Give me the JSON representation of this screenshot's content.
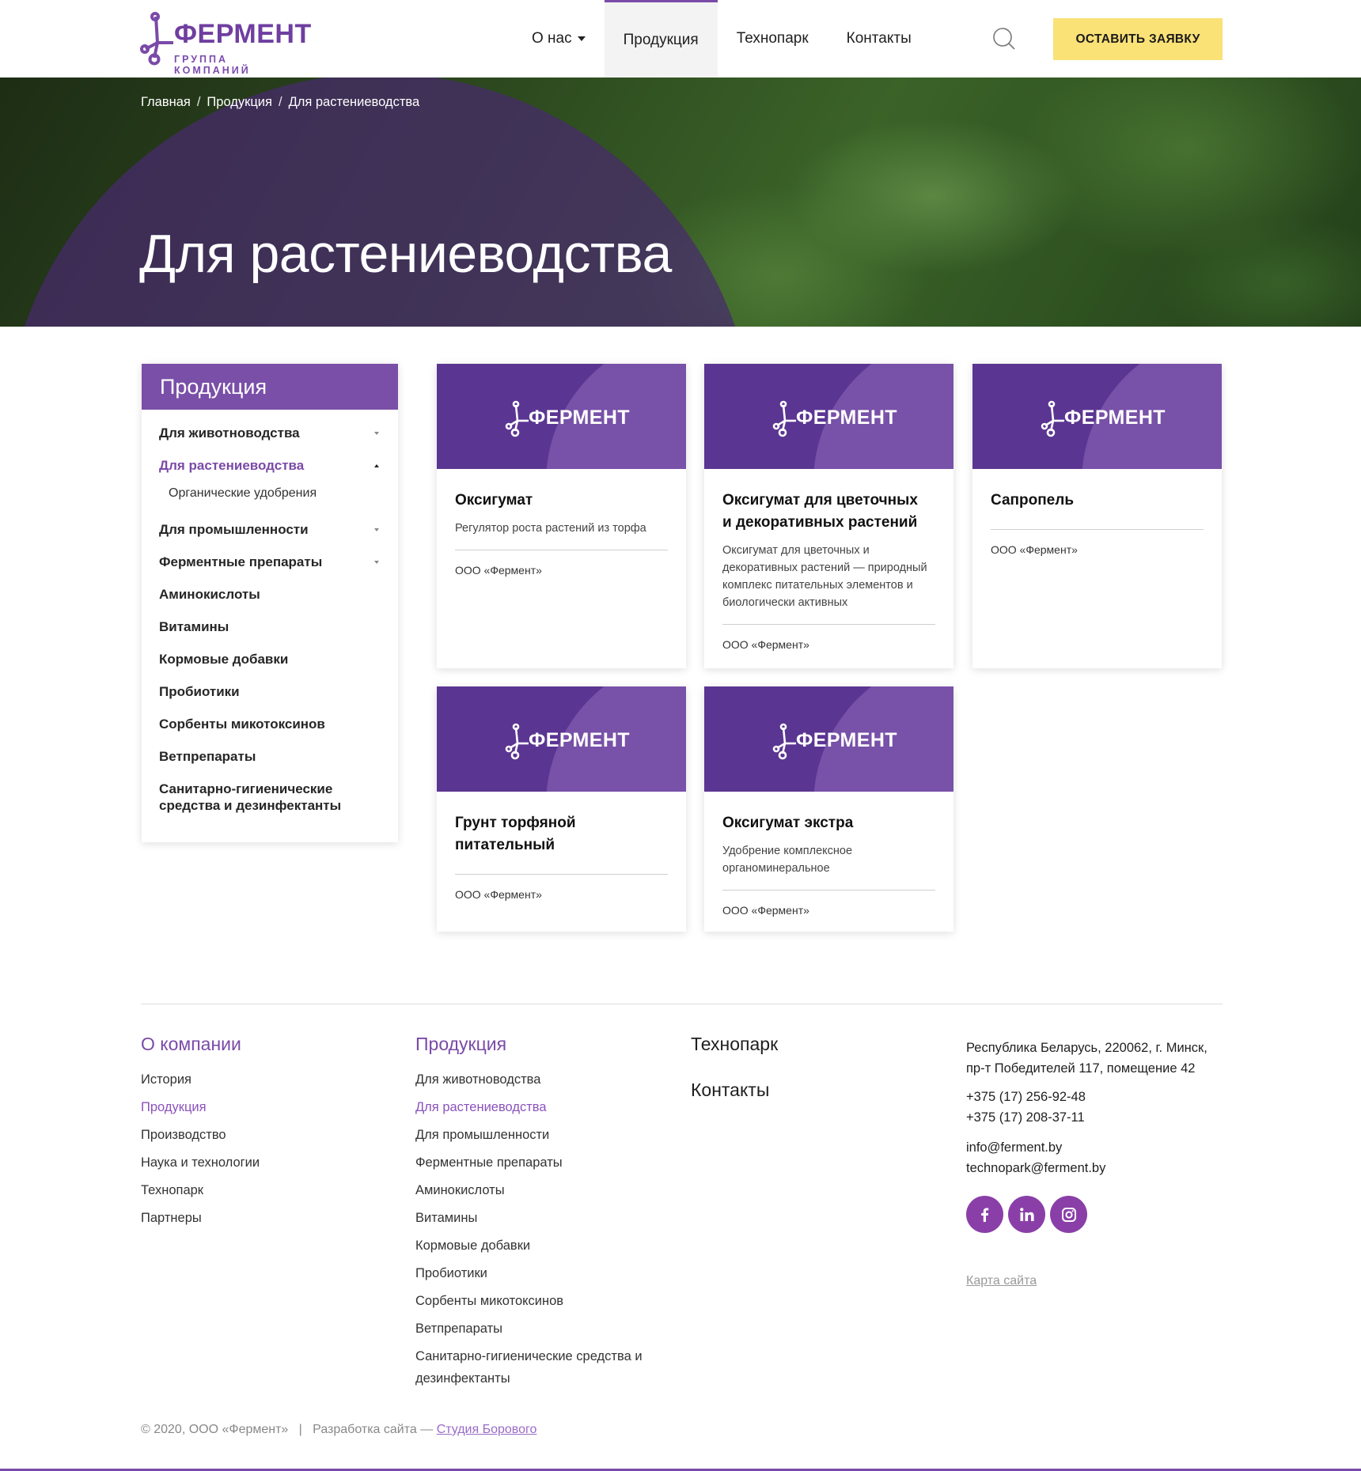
{
  "brand": {
    "name": "ФЕРМЕНТ",
    "tagline": "ГРУППА КОМПАНИЙ",
    "primary_color": "#7a4aa8",
    "accent_color": "#fae277"
  },
  "nav": {
    "items": [
      {
        "label": "О нас",
        "has_dropdown": true
      },
      {
        "label": "Продукция",
        "active": true
      },
      {
        "label": "Технопарк"
      },
      {
        "label": "Контакты"
      }
    ],
    "search_icon": "search-icon",
    "cta_label": "ОСТАВИТЬ ЗАЯВКУ"
  },
  "breadcrumb": [
    "Главная",
    "Продукция",
    "Для растениеводства"
  ],
  "breadcrumb_separator": "/",
  "hero": {
    "title": "Для растениеводства"
  },
  "sidebar": {
    "title": "Продукция",
    "items": [
      {
        "label": "Для животноводства",
        "toggle": "expand"
      },
      {
        "label": "Для растениеводства",
        "toggle": "collapse",
        "active": true
      },
      {
        "label": "Органические удобрения",
        "sub": true
      },
      {
        "label": "Для промышленности",
        "toggle": "expand"
      },
      {
        "label": "Ферментные препараты",
        "toggle": "expand"
      },
      {
        "label": "Аминокислоты"
      },
      {
        "label": "Витамины"
      },
      {
        "label": "Кормовые добавки"
      },
      {
        "label": "Пробиотики"
      },
      {
        "label": "Сорбенты микотоксинов"
      },
      {
        "label": "Ветпрепараты"
      },
      {
        "label": "Санитарно-гигиенические средства и дезинфектанты"
      }
    ]
  },
  "products": [
    {
      "logo": "ФЕРМЕНТ",
      "title": "Оксигумат",
      "description": "Регулятор роста растений из торфа",
      "company": "ООО «Фермент»"
    },
    {
      "logo": "ФЕРМЕНТ",
      "title": "Оксигумат для цветочных и декоративных растений",
      "description": "Оксигумат для цветочных и декоративных растений — природный комплекс питательных элементов и биологически активных",
      "company": "ООО «Фермент»"
    },
    {
      "logo": "ФЕРМЕНТ",
      "title": "Сапропель",
      "description": "",
      "company": "ООО «Фермент»"
    },
    {
      "logo": "ФЕРМЕНТ",
      "title": "Грунт торфяной питательный",
      "description": "",
      "company": "ООО «Фермент»"
    },
    {
      "logo": "ФЕРМЕНТ",
      "title": "Оксигумат экстра",
      "description": "Удобрение комплексное органоминеральное",
      "company": "ООО «Фермент»"
    }
  ],
  "footer": {
    "about": {
      "title": "О компании",
      "links": [
        "История",
        "Продукция",
        "Производство",
        "Наука и технологии",
        "Технопарк",
        "Партнеры"
      ]
    },
    "products": {
      "title": "Продукция",
      "links": [
        "Для животноводства",
        "Для растениеводства",
        "Для промышленности",
        "Ферментные препараты",
        "Аминокислоты",
        "Витамины",
        "Кормовые добавки",
        "Пробиотики",
        "Сорбенты микотоксинов",
        "Ветпрепараты",
        "Санитарно-гигиенические средства и дезинфектанты"
      ]
    },
    "technopark": "Технопарк",
    "contacts": "Контакты",
    "address": "Республика Беларусь, 220062, г. Минск, пр-т Победителей 117, помещение 42",
    "phones": [
      "+375 (17) 256-92-48",
      "+375 (17) 208-37-11"
    ],
    "emails": [
      "info@ferment.by",
      "technopark@ferment.by"
    ],
    "socials": [
      "facebook-icon",
      "linkedin-icon",
      "instagram-icon"
    ],
    "sitemap": "Карта сайта",
    "copyright": "© 2020, ООО «Фермент»",
    "copyright_separator": "|",
    "developer_prefix": "Разработка сайта —",
    "developer_link": "Студия Борового"
  }
}
